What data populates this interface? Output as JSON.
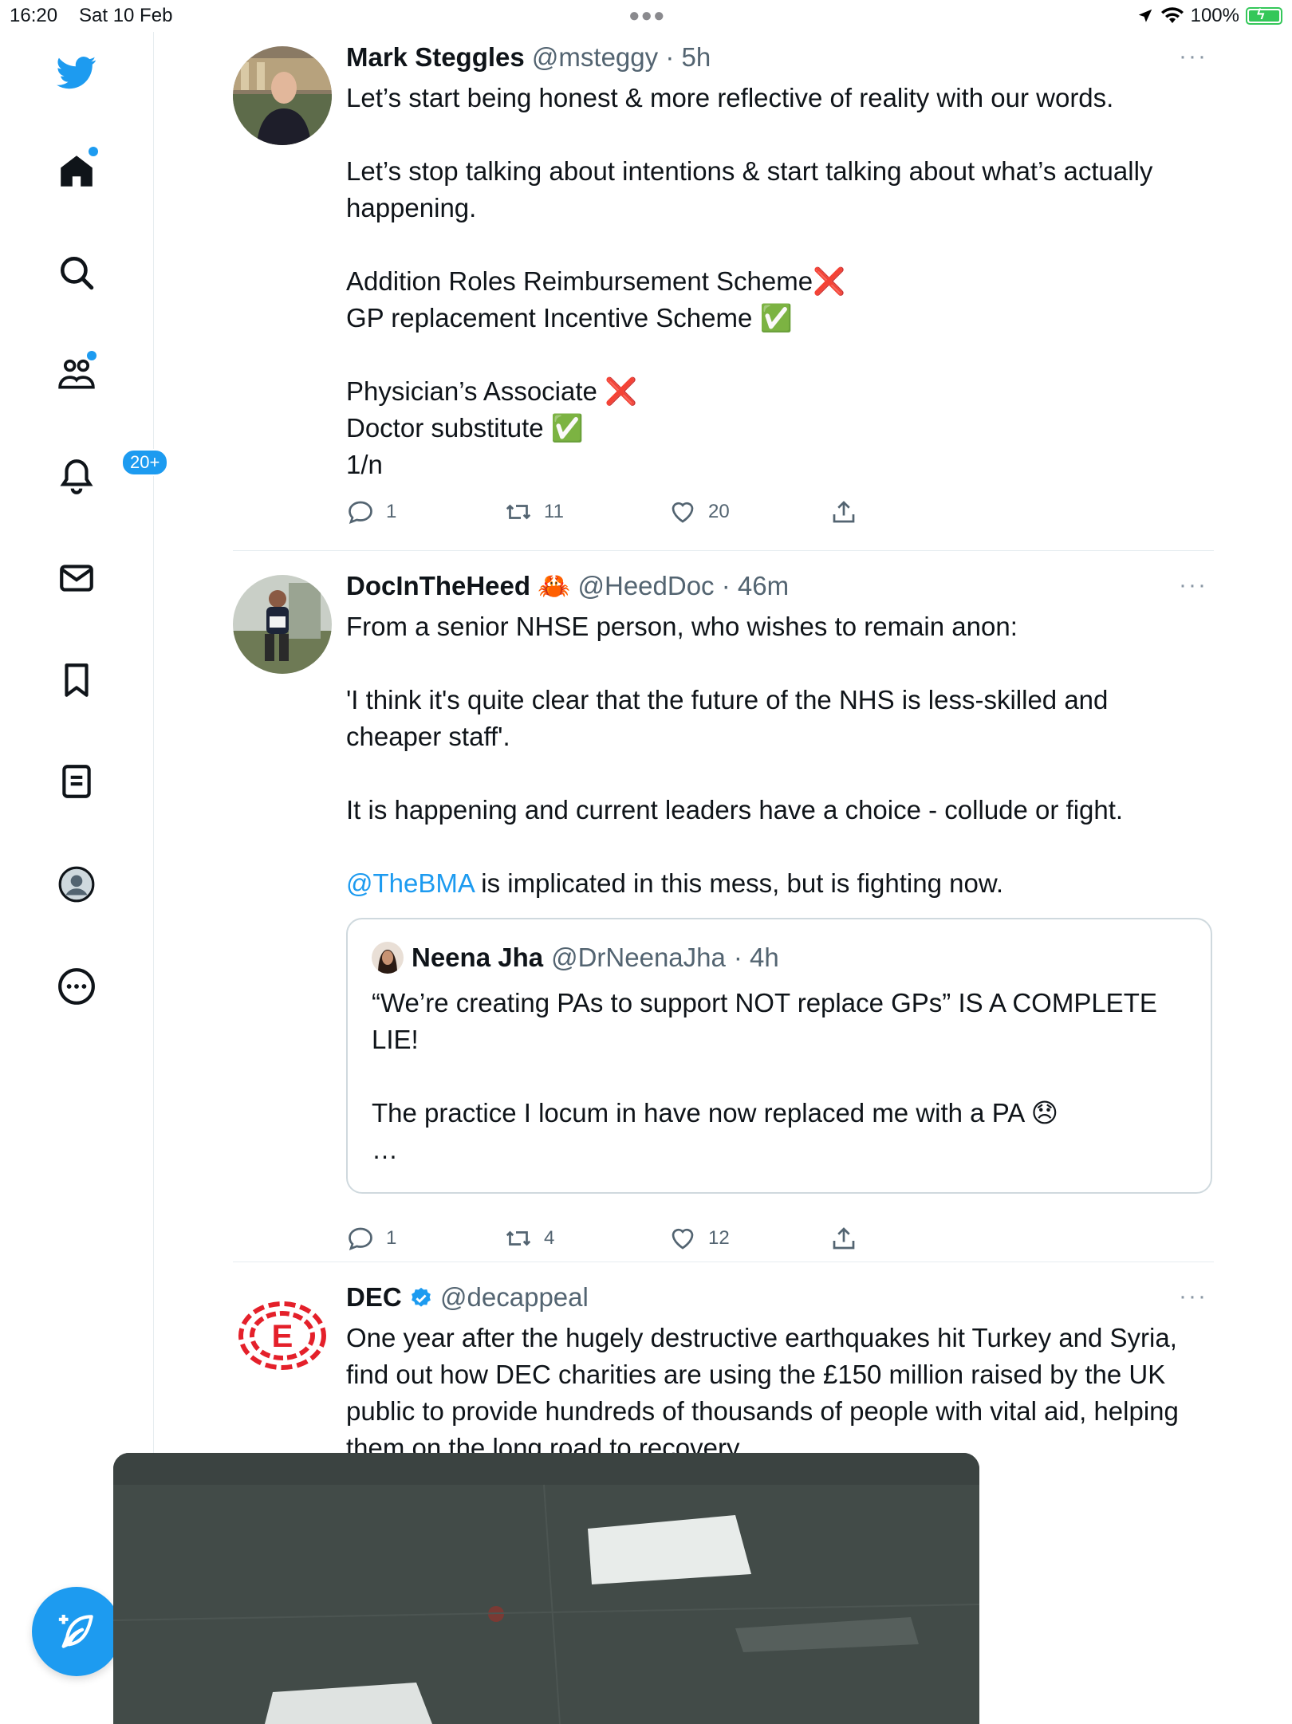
{
  "status_bar": {
    "time": "16:20",
    "date": "Sat 10 Feb",
    "battery": "100%"
  },
  "sidebar": {
    "items": [
      {
        "name": "twitter-logo",
        "color": "#1d9bf0"
      },
      {
        "name": "home",
        "has_dot": true
      },
      {
        "name": "search"
      },
      {
        "name": "communities",
        "has_dot": true
      },
      {
        "name": "notifications",
        "badge": "20+"
      },
      {
        "name": "messages"
      },
      {
        "name": "bookmarks"
      },
      {
        "name": "lists"
      },
      {
        "name": "profile"
      },
      {
        "name": "more"
      }
    ]
  },
  "tweets": [
    {
      "name": "Mark Steggles",
      "handle": "@msteggy",
      "time": "· 5h",
      "text": "Let’s start being honest & more reflective of reality with our words.\n\nLet’s stop talking about intentions & start talking about what’s actually happening.\n\nAddition Roles Reimbursement Scheme❌\nGP replacement Incentive Scheme ✅\n\nPhysician’s Associate ❌\nDoctor substitute ✅\n1/n",
      "replies": "1",
      "retweets": "11",
      "likes": "20"
    },
    {
      "name": "DocInTheHeed",
      "name_emoji": "🦀",
      "handle": "@HeedDoc",
      "time": "· 46m",
      "text": "From a senior NHSE person, who wishes to remain anon:\n\n'I think it's quite clear that the future of the NHS is less-skilled and cheaper staff'.\n\nIt is happening and current leaders have a choice - collude or fight.\n\n",
      "mention": "@TheBMA",
      "text_after_mention": " is implicated in this mess, but is fighting now.",
      "quote": {
        "name": "Neena Jha",
        "handle": "@DrNeenaJha",
        "time": "· 4h",
        "text": "“We’re creating PAs to support NOT replace GPs” IS A COMPLETE LIE!\n\nThe practice I locum in have now replaced me with a PA 😞\n…"
      },
      "replies": "1",
      "retweets": "4",
      "likes": "12"
    },
    {
      "name": "DEC",
      "verified": true,
      "handle": "@decappeal",
      "text": "One year after the hugely destructive earthquakes hit Turkey and Syria, find out how DEC charities are using the £150 million raised by the UK public to provide hundreds of thousands of people with vital aid, helping them on the long road to recovery."
    }
  ],
  "colors": {
    "accent": "#1d9bf0",
    "text": "#0f1419",
    "secondary": "#536471",
    "dec_red": "#e4202a"
  }
}
